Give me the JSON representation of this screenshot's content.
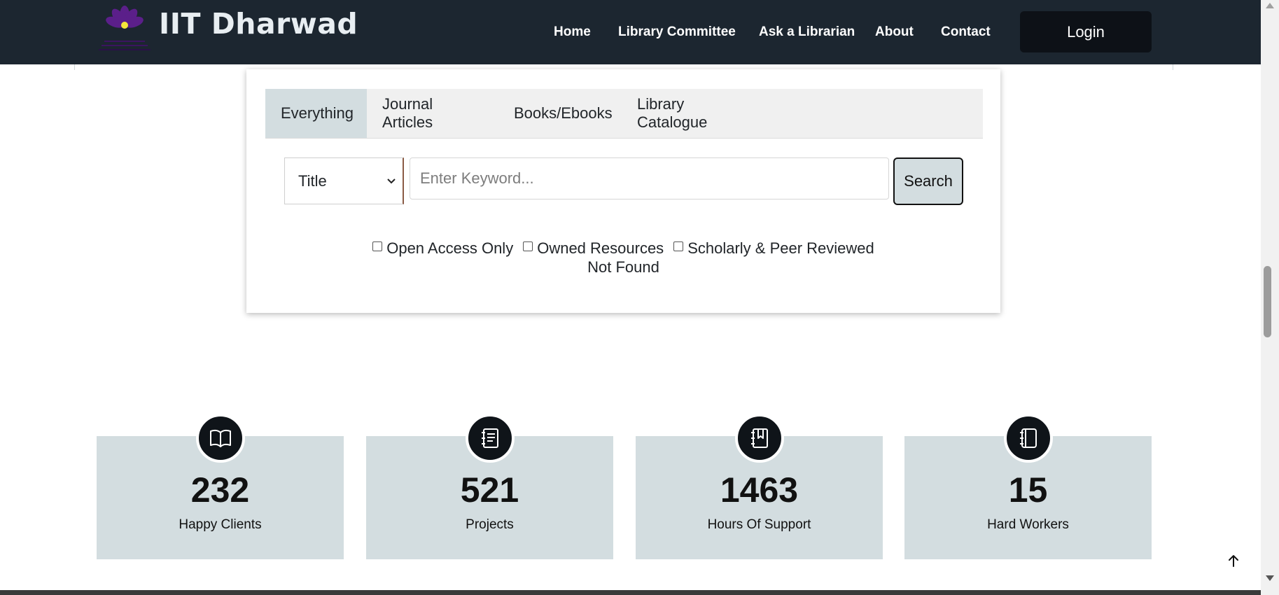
{
  "navbar": {
    "brand": "IIT Dharwad",
    "links": [
      "Home",
      "Library Committee",
      "Ask a Librarian",
      "About",
      "Contact"
    ],
    "login_label": "Login"
  },
  "search": {
    "tabs": [
      "Everything",
      "Journal Articles",
      "Books/Ebooks",
      "Library Catalogue"
    ],
    "active_tab": "Everything",
    "field_select": "Title",
    "keyword_placeholder": "Enter Keyword...",
    "keyword_value": "",
    "search_label": "Search",
    "filters": [
      {
        "label": "Open Access Only",
        "checked": false
      },
      {
        "label": "Owned Resources",
        "checked": false
      },
      {
        "label": "Scholarly & Peer Reviewed",
        "checked": false
      }
    ],
    "status_text": "Not Found"
  },
  "stats": [
    {
      "value": "232",
      "label": "Happy Clients",
      "icon": "open-book-icon"
    },
    {
      "value": "521",
      "label": "Projects",
      "icon": "journal-text-icon"
    },
    {
      "value": "1463",
      "label": "Hours Of Support",
      "icon": "journal-bookmark-icon"
    },
    {
      "value": "15",
      "label": "Hard Workers",
      "icon": "notebook-icon"
    }
  ],
  "colors": {
    "navbar_bg": "#1c2630",
    "login_bg": "#0d1117",
    "tab_active_bg": "#d3dde0",
    "stat_card_bg": "#d3dde0",
    "logo_purple": "#5b1f8a",
    "logo_yellow": "#f5e63a"
  }
}
